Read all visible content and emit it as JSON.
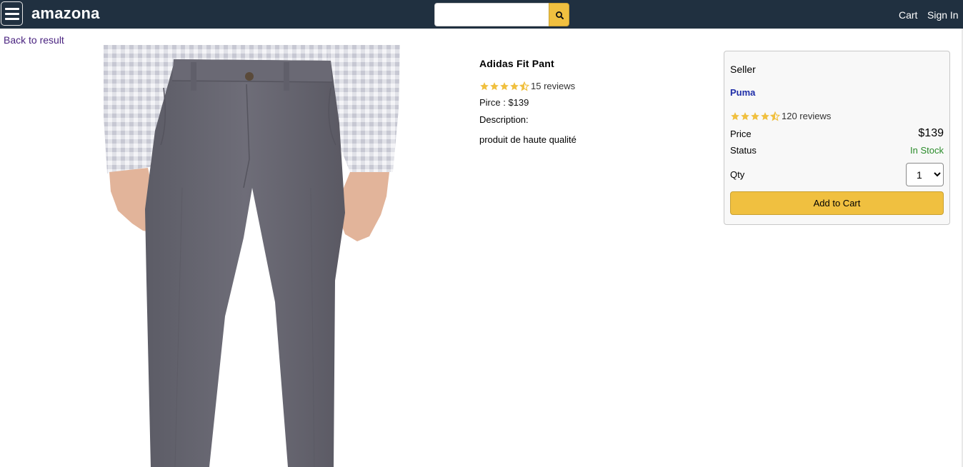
{
  "header": {
    "brand": "amazona",
    "search_placeholder": "",
    "nav": {
      "cart": "Cart",
      "signin": "Sign In"
    }
  },
  "back_link": "Back to result",
  "product": {
    "name": "Adidas Fit Pant",
    "rating": 4.5,
    "reviews_text": "15 reviews",
    "price_line": "Pirce : $139",
    "description_label": "Description:",
    "description": "produit de haute qualité",
    "image_icon": "grey-chino-pants-photo"
  },
  "seller_card": {
    "seller_label": "Seller",
    "seller_name": "Puma",
    "rating": 4.5,
    "reviews_text": "120 reviews",
    "price_label": "Price",
    "price_value": "$139",
    "status_label": "Status",
    "status_value": "In Stock",
    "qty_label": "Qty",
    "qty_selected": "1",
    "add_button": "Add to Cart"
  },
  "colors": {
    "header_bg": "#203040",
    "accent": "#f0c040",
    "star": "#f0c040",
    "in_stock": "#2a8b2a",
    "seller_link": "#1f2ea8",
    "back_link": "#4a2380"
  },
  "icons": {
    "menu": "hamburger-icon",
    "search": "search-icon",
    "star": "star-icon",
    "dropdown": "chevron-down-icon"
  }
}
